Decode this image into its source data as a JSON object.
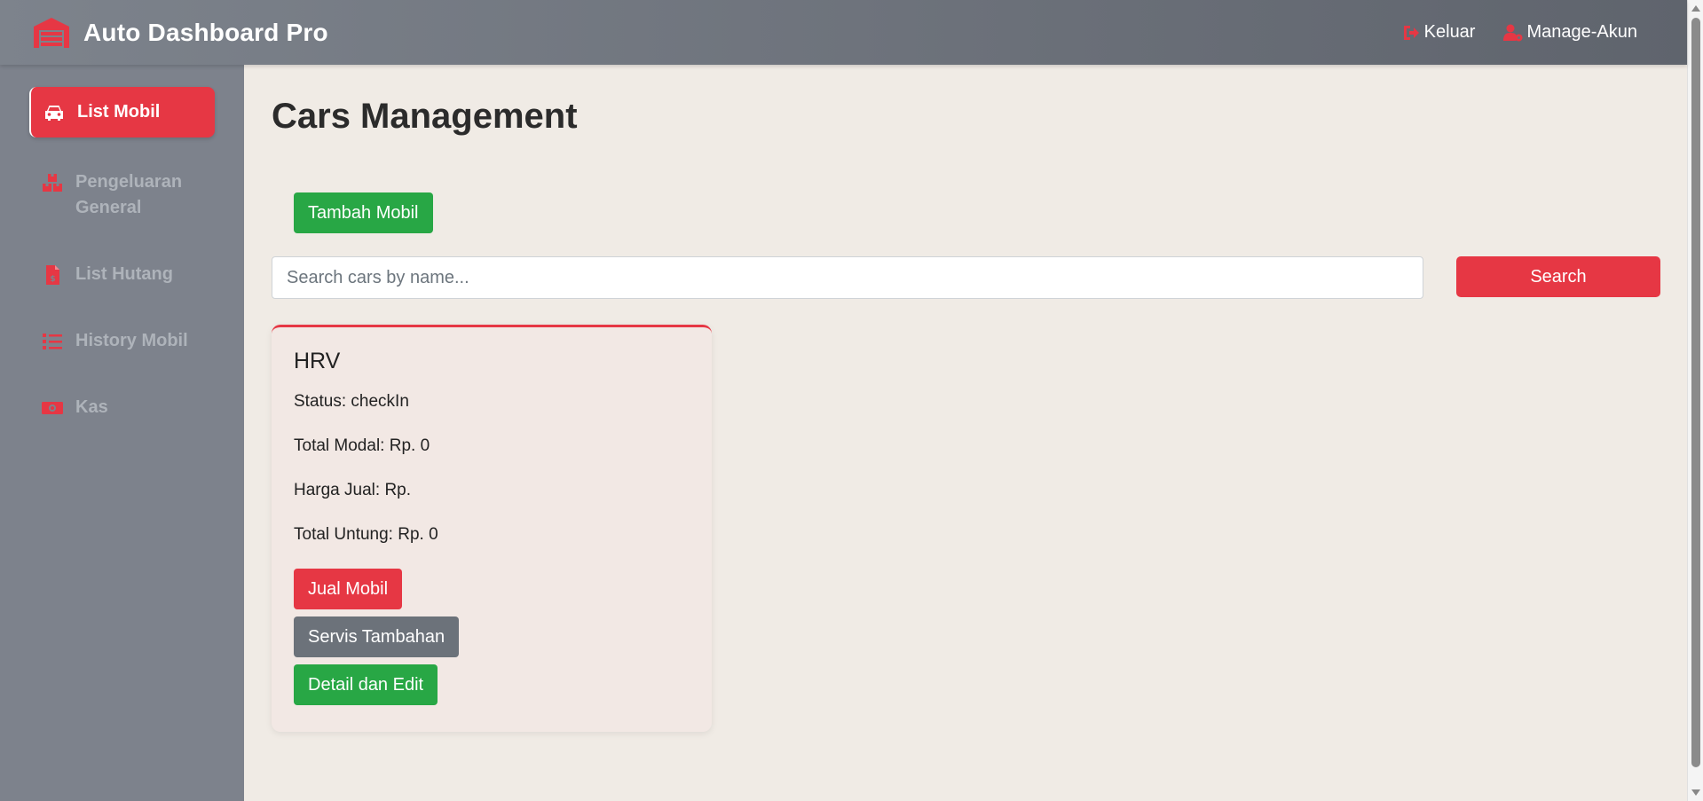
{
  "app": {
    "title": "Auto Dashboard Pro",
    "logo_icon": "garage-icon"
  },
  "header": {
    "logout_label": "Keluar",
    "logout_icon": "logout-icon",
    "manage_label": "Manage-Akun",
    "manage_icon": "user-gear-icon"
  },
  "sidebar": {
    "items": [
      {
        "label": "List Mobil",
        "icon": "car-icon",
        "active": true
      },
      {
        "label": "Pengeluaran General",
        "icon": "boxes-icon",
        "active": false
      },
      {
        "label": "List Hutang",
        "icon": "invoice-icon",
        "active": false
      },
      {
        "label": "History Mobil",
        "icon": "list-icon",
        "active": false
      },
      {
        "label": "Kas",
        "icon": "money-icon",
        "active": false
      }
    ]
  },
  "main": {
    "title": "Cars Management",
    "add_button": "Tambah Mobil",
    "search": {
      "placeholder": "Search cars by name...",
      "value": "",
      "button": "Search"
    }
  },
  "cars": [
    {
      "name": "HRV",
      "status": "Status: checkIn",
      "total_modal": "Total Modal: Rp. 0",
      "harga_jual": "Harga Jual: Rp.",
      "total_untung": "Total Untung: Rp. 0",
      "sell_button": "Jual Mobil",
      "service_button": "Servis Tambahan",
      "detail_button": "Detail dan Edit"
    }
  ],
  "colors": {
    "accent": "#e63744",
    "success": "#28a745",
    "secondary": "#6c727a",
    "sidebar": "#7d828c",
    "background": "#f0ebe5"
  }
}
